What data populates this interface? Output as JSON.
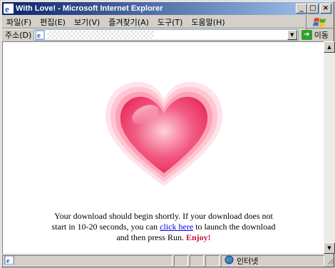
{
  "window": {
    "title": "With Love! - Microsoft Internet Explorer",
    "caption_buttons": {
      "minimize": "_",
      "maximize": "□",
      "close": "×"
    }
  },
  "menubar": {
    "items": [
      {
        "label": "파일(F)",
        "name": "file"
      },
      {
        "label": "편집(E)",
        "name": "edit"
      },
      {
        "label": "보기(V)",
        "name": "view"
      },
      {
        "label": "즐겨찾기(A)",
        "name": "favorites"
      },
      {
        "label": "도구(T)",
        "name": "tools"
      },
      {
        "label": "도움말(H)",
        "name": "help"
      }
    ]
  },
  "addressbar": {
    "label": "주소(D)",
    "url": "",
    "go_label": "이동",
    "dropdown_glyph": "▼",
    "go_glyph": "➔"
  },
  "content": {
    "message_part1": "Your download should begin shortly. If your download does not start in 10-20 seconds, you can",
    "link_text": "click here",
    "message_part2": "to launch the download and then press Run.",
    "enjoy": "Enjoy!",
    "heart_color": "#f23a6a",
    "enjoy_color": "#c0144a"
  },
  "scrollbar": {
    "up_glyph": "▲",
    "down_glyph": "▼"
  },
  "statusbar": {
    "status_text": "",
    "zone_label": "인터넷"
  },
  "icons": {
    "app": "ie-icon",
    "page": "ie-page-icon",
    "go": "go-arrow-icon",
    "zone": "internet-globe-icon",
    "windows_logo": "windows-logo-icon",
    "heart": "heart-image"
  }
}
